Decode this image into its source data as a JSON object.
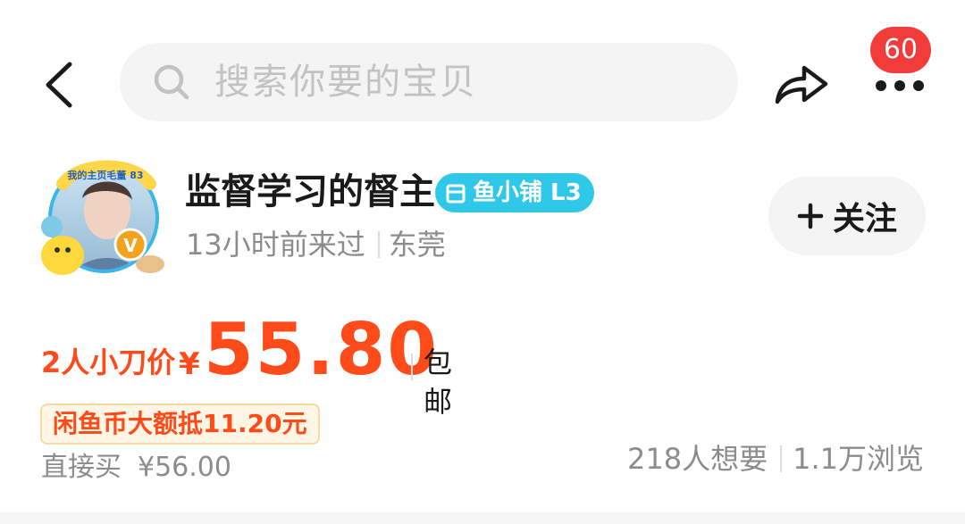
{
  "header": {
    "search_placeholder": "搜索你要的宝贝",
    "notification_count": "60"
  },
  "seller": {
    "name": "监督学习的督主",
    "shop_badge": "鱼小铺 L3",
    "last_seen": "13小时前来过",
    "location": "东莞",
    "follow_label": "关注",
    "avatar_banner": "我的主页毛董 83",
    "avatar_v_badge": "V"
  },
  "price": {
    "label": "2人小刀价",
    "currency": "¥",
    "value": "55.80",
    "shipping": "包邮"
  },
  "coin_deduction": "闲鱼币大额抵11.20元",
  "direct_buy": {
    "label": "直接买",
    "price": "¥56.00"
  },
  "stats": {
    "wants": "218人想要",
    "views": "1.1万浏览"
  },
  "colors": {
    "accent": "#ff4a1a",
    "badge_red": "#f23b3b",
    "shop_badge_bg": "#30c8e8",
    "muted_text": "#8c8c8c"
  }
}
